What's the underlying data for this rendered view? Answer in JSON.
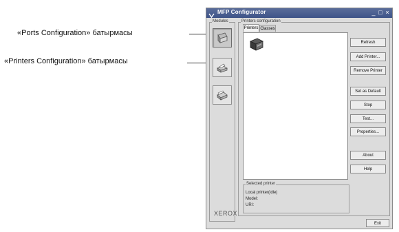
{
  "callouts": {
    "ports": "«Ports Configuration» батырмасы",
    "printers": "«Printers Configuration» батырмасы"
  },
  "window": {
    "title": "MFP Configurator",
    "controls": {
      "minimize": "_",
      "maximize": "□",
      "close": "×"
    }
  },
  "modules": {
    "label": "Modules",
    "brand": "XEROX"
  },
  "printers_config": {
    "label": "Printers configuration",
    "tabs": [
      "Printers",
      "Classes"
    ],
    "buttons": {
      "refresh": "Refresh",
      "add_printer": "Add Printer...",
      "remove_printer": "Remove Printer",
      "set_default": "Set as Default",
      "stop": "Stop",
      "test": "Test...",
      "properties": "Properties...",
      "about": "About",
      "help": "Help"
    },
    "selected_printer": {
      "label": "Selected printer",
      "lines": [
        "Local printer(idle)",
        "Model:",
        "URI:"
      ]
    }
  },
  "exit_label": "Exit",
  "colors": {
    "titlebar": "#4a5e90",
    "window_bg": "#dcdcdc"
  }
}
